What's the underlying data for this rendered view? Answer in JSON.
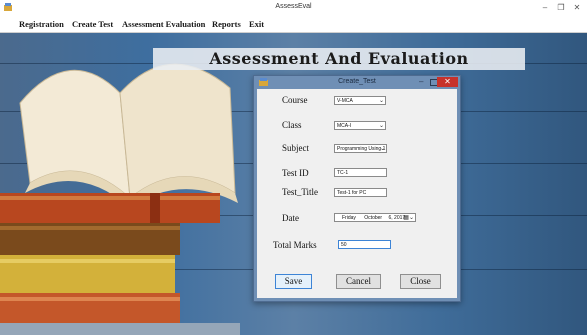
{
  "app": {
    "title": "AssessEval"
  },
  "menu": {
    "items": [
      "Registration",
      "Create Test",
      "Assessment Evaluation",
      "Reports",
      "Exit"
    ]
  },
  "banner": {
    "heading": "Assessment And Evaluation"
  },
  "dialog": {
    "title": "Create_Test",
    "fields": {
      "course": {
        "label": "Course",
        "value": "V-MCA"
      },
      "class": {
        "label": "Class",
        "value": "MCA-I"
      },
      "subject": {
        "label": "Subject",
        "value": "Programming Using 1"
      },
      "test_id": {
        "label": "Test ID",
        "value": "TC-1"
      },
      "test_title": {
        "label": "Test_Title",
        "value": "Test-1 for PC"
      },
      "date": {
        "label": "Date",
        "day": "Friday",
        "month": "October",
        "daynum": "6, 2017"
      },
      "total_marks": {
        "label": "Total Marks",
        "value": "50"
      }
    },
    "buttons": {
      "save": "Save",
      "cancel": "Cancel",
      "close": "Close"
    }
  },
  "icons": {
    "app": "app-icon",
    "minimize": "minimize-icon",
    "maximize": "maximize-icon",
    "close": "close-icon",
    "dropdown": "chevron-down-icon",
    "calendar": "calendar-icon"
  },
  "colors": {
    "close_button": "#c7322b",
    "dialog_frame": "#6f8fb5",
    "focus_border": "#3d84d6"
  }
}
